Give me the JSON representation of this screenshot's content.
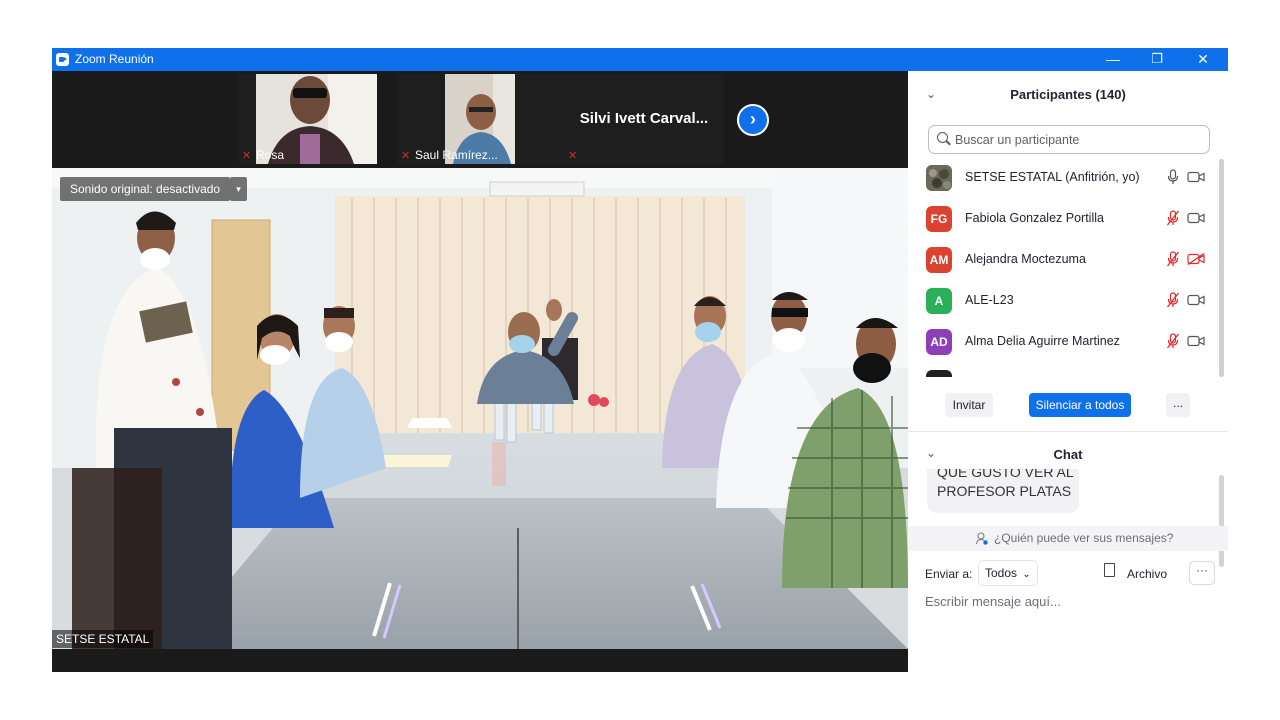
{
  "window": {
    "title": "Zoom Reunión"
  },
  "controls": {
    "minimize": "—",
    "restore": "❐",
    "close": "✕"
  },
  "gallery": {
    "thumbnails": [
      {
        "name": "Rosa",
        "muted": true
      },
      {
        "name": "Saul Ramírez...",
        "muted": true
      },
      {
        "name": "",
        "display_name": "Silvi  Ivett  Carval...",
        "muted": true
      }
    ],
    "next_label": "›"
  },
  "main_video": {
    "sound_button": "Sonido original: desactivado",
    "sound_dropdown": "▾",
    "speaker": "SETSE ESTATAL"
  },
  "participants": {
    "header": "Participantes (140)",
    "search_placeholder": "Buscar un participante",
    "list": [
      {
        "initials": "",
        "name": "SETSE ESTATAL (Anfitrión, yo)",
        "color": "#6b6a58",
        "mic_muted": false,
        "video_off": false
      },
      {
        "initials": "FG",
        "name": " Fabiola Gonzalez Portilla",
        "color": "#d9432f",
        "mic_muted": true,
        "video_off": false
      },
      {
        "initials": "AM",
        "name": "Alejandra Moctezuma",
        "color": "#d9432f",
        "mic_muted": true,
        "video_off": true
      },
      {
        "initials": "A",
        "name": "ALE-L23",
        "color": "#2bb05a",
        "mic_muted": true,
        "video_off": false
      },
      {
        "initials": "AD",
        "name": "Alma Delia Aguirre Martinez",
        "color": "#8d3fb8",
        "mic_muted": true,
        "video_off": false
      }
    ],
    "invite": "Invitar",
    "mute_all": "Silenciar a todos",
    "more": "..."
  },
  "chat": {
    "header": "Chat",
    "message_lines": [
      "QUE GUSTO VER AL",
      "PROFESOR PLATAS"
    ],
    "who_can_see": "¿Quién puede ver sus mensajes?",
    "send_to_label": "Enviar a:",
    "send_to_value": "Todos",
    "file_label": "Archivo",
    "more": "···",
    "input_placeholder": "Escribir mensaje aquí..."
  },
  "colors": {
    "brand": "#0e71eb",
    "muted": "#e02828"
  }
}
